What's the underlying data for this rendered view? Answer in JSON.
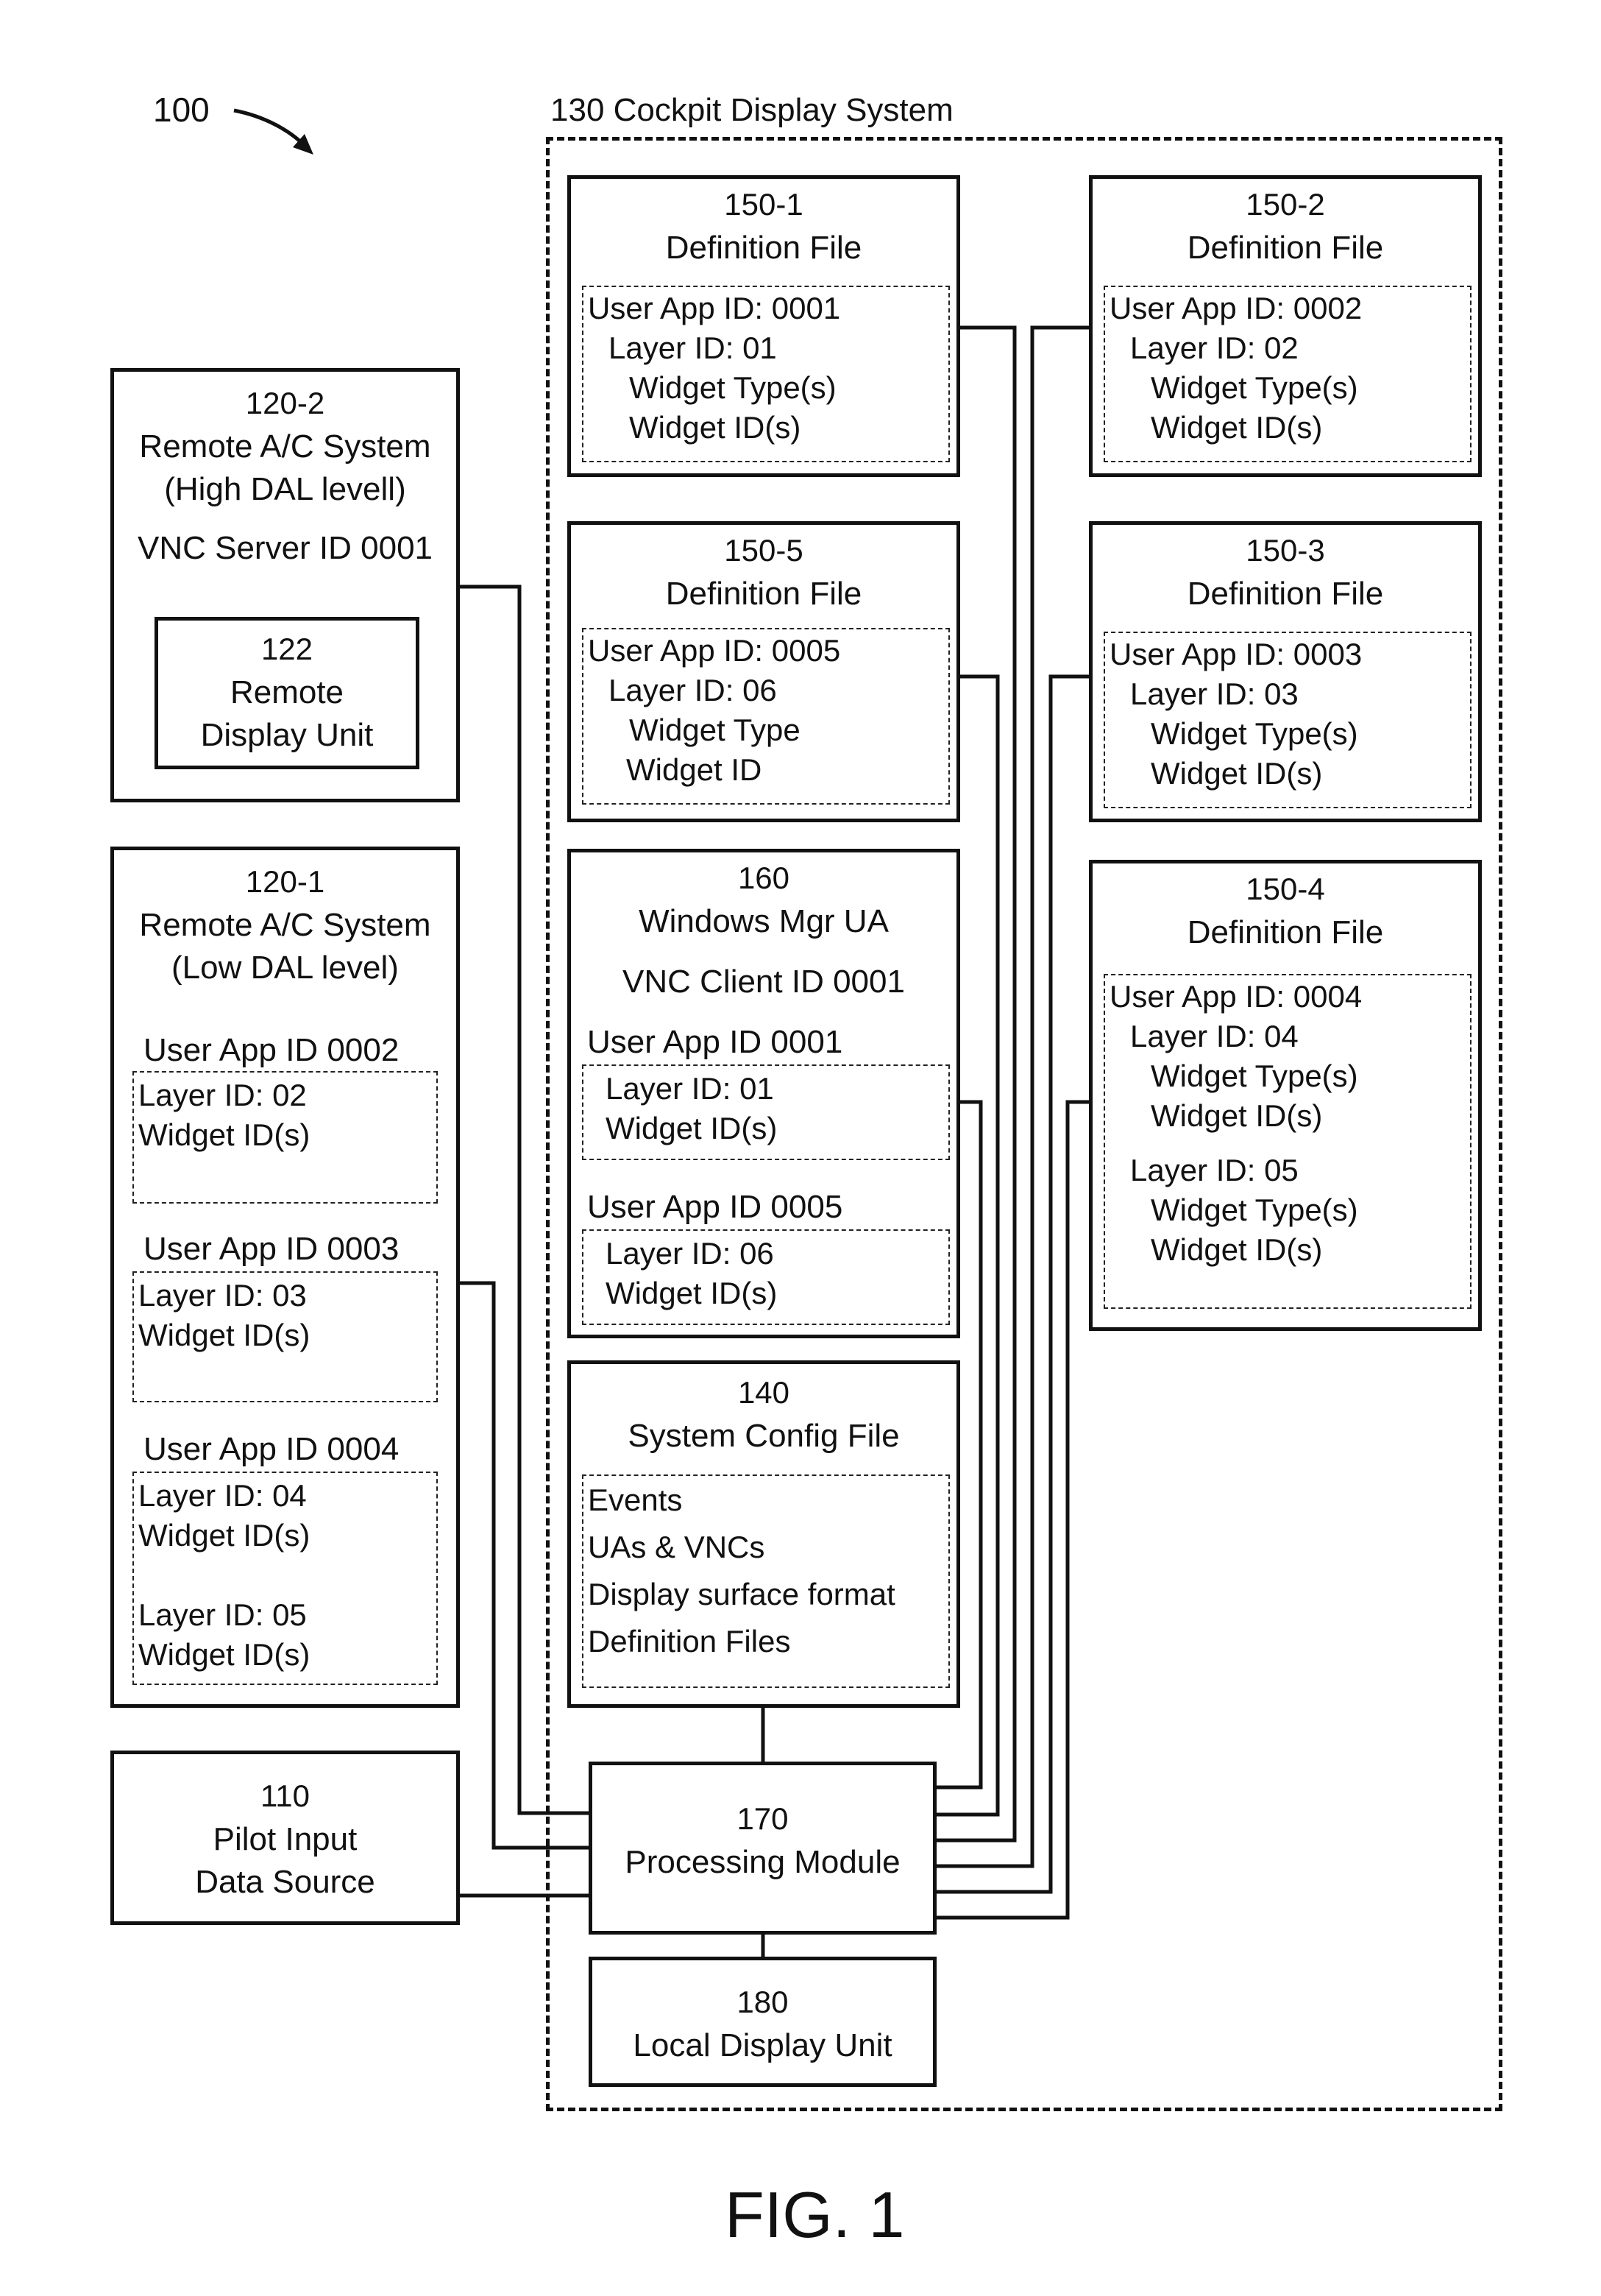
{
  "figure": {
    "ref_label": "100",
    "caption": "FIG. 1"
  },
  "cockpit_display_system": {
    "title": "130 Cockpit Display System"
  },
  "remote_high": {
    "ref": "120-2",
    "title": "Remote A/C System",
    "subtitle": "(High DAL levell)",
    "vnc": "VNC Server ID 0001",
    "display": {
      "ref": "122",
      "line1": "Remote",
      "line2": "Display Unit"
    }
  },
  "remote_low": {
    "ref": "120-1",
    "title": "Remote A/C System",
    "subtitle": "(Low DAL level)",
    "apps": [
      {
        "label": "User App ID 0002",
        "lines": [
          "Layer ID: 02",
          "Widget ID(s)"
        ]
      },
      {
        "label": "User App ID 0003",
        "lines": [
          "Layer ID: 03",
          "Widget ID(s)"
        ]
      },
      {
        "label": "User App ID 0004",
        "lines": [
          "Layer ID: 04",
          "Widget ID(s)",
          "Layer ID: 05",
          "Widget ID(s)"
        ]
      }
    ]
  },
  "pilot_input": {
    "ref": "110",
    "line1": "Pilot Input",
    "line2": "Data Source"
  },
  "definition_files": [
    {
      "ref": "150-1",
      "title": "Definition File",
      "app": "User App ID: 0001",
      "layer": "Layer ID: 01",
      "type": "Widget Type(s)",
      "id": "Widget ID(s)"
    },
    {
      "ref": "150-2",
      "title": "Definition File",
      "app": "User App ID: 0002",
      "layer": "Layer ID: 02",
      "type": "Widget Type(s)",
      "id": "Widget ID(s)"
    },
    {
      "ref": "150-5",
      "title": "Definition File",
      "app": "User App ID: 0005",
      "layer": "Layer ID: 06",
      "type": "Widget Type",
      "id": "Widget ID"
    },
    {
      "ref": "150-3",
      "title": "Definition File",
      "app": "User App ID: 0003",
      "layer": "Layer ID: 03",
      "type": "Widget Type(s)",
      "id": "Widget ID(s)"
    },
    {
      "ref": "150-4",
      "title": "Definition File",
      "app": "User App ID: 0004",
      "layer": "Layer ID: 04",
      "type": "Widget Type(s)",
      "id": "Widget ID(s)",
      "layer2": "Layer ID: 05",
      "type2": "Widget Type(s)",
      "id2": "Widget ID(s)"
    }
  ],
  "windows_mgr": {
    "ref": "160",
    "title": "Windows Mgr UA",
    "vnc": "VNC Client ID 0001",
    "apps": [
      {
        "label": "User App ID 0001",
        "lines": [
          "Layer ID: 01",
          "Widget ID(s)"
        ]
      },
      {
        "label": "User App ID 0005",
        "lines": [
          "Layer ID: 06",
          "Widget ID(s)"
        ]
      }
    ]
  },
  "system_config": {
    "ref": "140",
    "title": "System Config File",
    "items": [
      "Events",
      "UAs & VNCs",
      "Display surface format",
      "Definition Files"
    ]
  },
  "processing_module": {
    "ref": "170",
    "title": "Processing Module"
  },
  "local_display": {
    "ref": "180",
    "title": "Local Display Unit"
  }
}
